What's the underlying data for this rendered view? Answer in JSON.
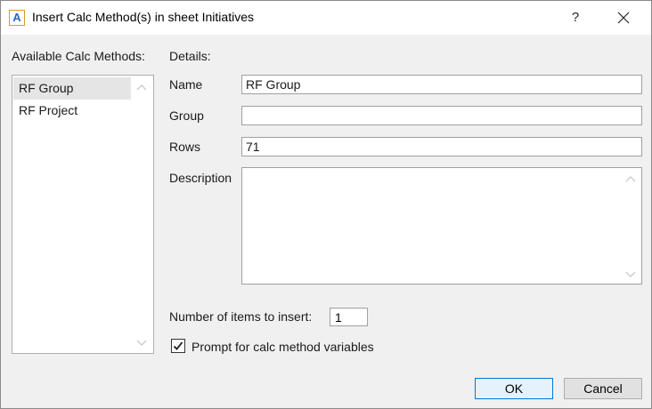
{
  "window": {
    "title": "Insert Calc Method(s) in sheet Initiatives",
    "app_icon_letter": "A",
    "help_glyph": "?"
  },
  "available": {
    "label": "Available Calc Methods:",
    "items": [
      {
        "label": "RF Group",
        "selected": true
      },
      {
        "label": "RF Project",
        "selected": false
      }
    ]
  },
  "details": {
    "heading": "Details:",
    "name_label": "Name",
    "name_value": "RF Group",
    "group_label": "Group",
    "group_value": "",
    "rows_label": "Rows",
    "rows_value": "71",
    "description_label": "Description",
    "description_value": ""
  },
  "insert": {
    "count_label": "Number of items to insert:",
    "count_value": "1",
    "prompt_label": "Prompt for calc method variables",
    "prompt_checked": true
  },
  "buttons": {
    "ok": "OK",
    "cancel": "Cancel"
  },
  "colors": {
    "accent": "#0078d7",
    "icon_border": "#d79a2b",
    "icon_letter": "#2a63c5"
  }
}
